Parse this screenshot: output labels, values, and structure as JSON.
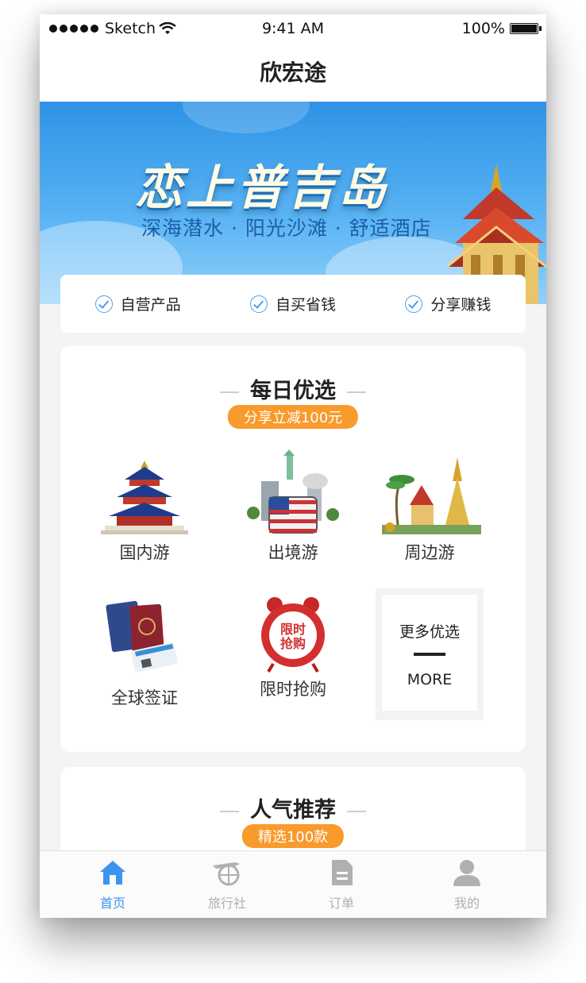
{
  "status_bar": {
    "carrier": "Sketch",
    "time": "9:41 AM",
    "battery": "100%"
  },
  "nav": {
    "title": "欣宏途"
  },
  "banner": {
    "headline": "恋上普吉岛",
    "subline": "深海潜水 · 阳光沙滩 · 舒适酒店"
  },
  "features": [
    {
      "label": "自营产品",
      "icon": "check-circle-icon"
    },
    {
      "label": "自买省钱",
      "icon": "check-circle-icon"
    },
    {
      "label": "分享赚钱",
      "icon": "check-circle-icon"
    }
  ],
  "daily": {
    "title": "每日优选",
    "badge": "分享立减100元",
    "items": [
      {
        "label": "国内游",
        "icon": "temple-of-heaven-icon"
      },
      {
        "label": "出境游",
        "icon": "world-landmarks-icon"
      },
      {
        "label": "周边游",
        "icon": "thai-temple-icon"
      },
      {
        "label": "全球签证",
        "icon": "passport-icon"
      },
      {
        "label": "限时抢购",
        "icon": "alarm-clock-icon"
      }
    ],
    "more": {
      "title": "更多优选",
      "subtitle": "MORE"
    }
  },
  "popular": {
    "title": "人气推荐",
    "badge": "精选100款"
  },
  "tabs": [
    {
      "label": "首页",
      "icon": "home-icon",
      "active": true
    },
    {
      "label": "旅行社",
      "icon": "airplane-globe-icon",
      "active": false
    },
    {
      "label": "订单",
      "icon": "document-icon",
      "active": false
    },
    {
      "label": "我的",
      "icon": "user-icon",
      "active": false
    }
  ],
  "colors": {
    "accent": "#3b95ee",
    "badge": "#f99a2c",
    "inactive_tab": "#b0b0b0"
  }
}
